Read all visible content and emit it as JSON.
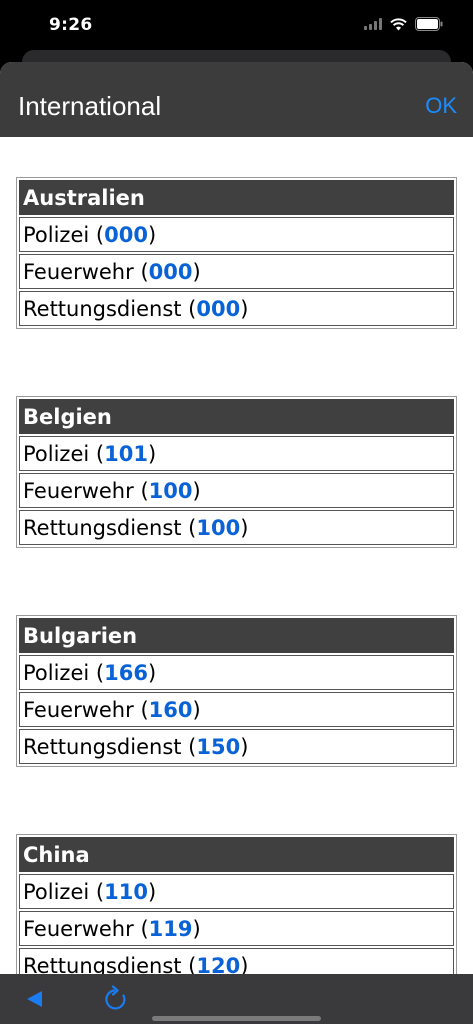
{
  "status": {
    "time": "9:26"
  },
  "nav": {
    "title": "International",
    "ok_label": "OK"
  },
  "countries": [
    {
      "name": "Australien",
      "rows": [
        {
          "label": "Polizei",
          "number": "000"
        },
        {
          "label": "Feuerwehr",
          "number": "000"
        },
        {
          "label": "Rettungsdienst",
          "number": "000"
        }
      ]
    },
    {
      "name": "Belgien",
      "rows": [
        {
          "label": "Polizei",
          "number": "101"
        },
        {
          "label": "Feuerwehr",
          "number": "100"
        },
        {
          "label": "Rettungsdienst",
          "number": "100"
        }
      ]
    },
    {
      "name": "Bulgarien",
      "rows": [
        {
          "label": "Polizei",
          "number": "166"
        },
        {
          "label": "Feuerwehr",
          "number": "160"
        },
        {
          "label": "Rettungsdienst",
          "number": "150"
        }
      ]
    },
    {
      "name": "China",
      "rows": [
        {
          "label": "Polizei",
          "number": "110"
        },
        {
          "label": "Feuerwehr",
          "number": "119"
        },
        {
          "label": "Rettungsdienst",
          "number": "120"
        }
      ]
    }
  ],
  "toolbar": {
    "back_icon": "back-triangle-icon",
    "reload_icon": "reload-icon"
  },
  "colors": {
    "accent": "#1a8cff",
    "number": "#0a63d6",
    "header": "#404040"
  }
}
